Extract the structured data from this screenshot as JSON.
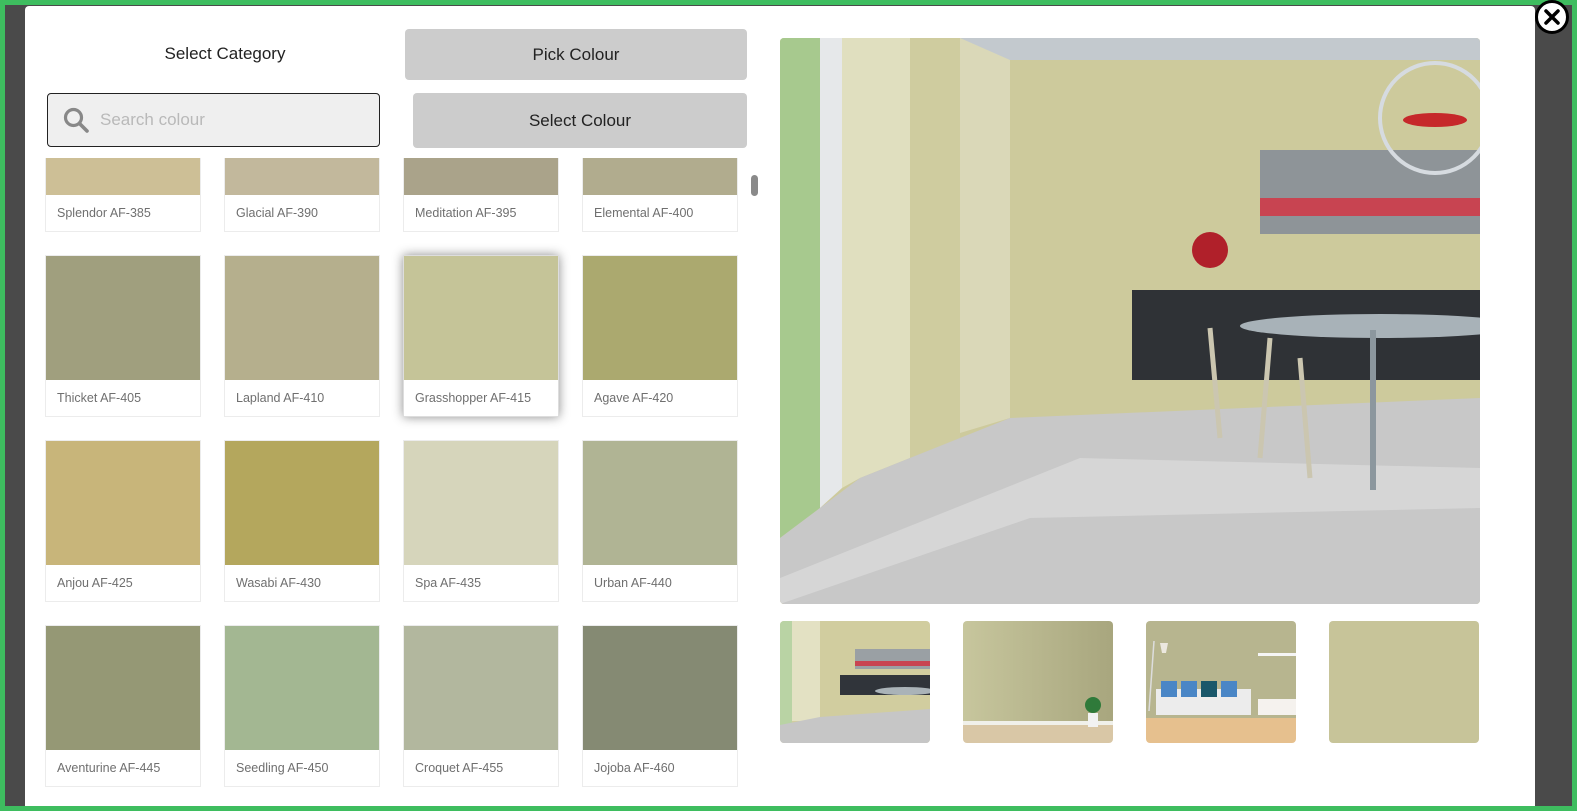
{
  "header": {
    "category_label": "Select Category",
    "pick_colour_label": "Pick Colour",
    "select_colour_label": "Select Colour"
  },
  "search": {
    "placeholder": "Search colour",
    "value": ""
  },
  "close_icon": "close-circle-icon",
  "selected_colour": "Grasshopper AF-415",
  "swatches": [
    {
      "name": "Splendor AF-385",
      "color": "#cdbf96"
    },
    {
      "name": "Glacial AF-390",
      "color": "#c2b89c"
    },
    {
      "name": "Meditation AF-395",
      "color": "#aaa38a"
    },
    {
      "name": "Elemental AF-400",
      "color": "#b1ac8e"
    },
    {
      "name": "Thicket AF-405",
      "color": "#a09f7e"
    },
    {
      "name": "Lapland AF-410",
      "color": "#b5af8d"
    },
    {
      "name": "Grasshopper AF-415",
      "color": "#c5c498"
    },
    {
      "name": "Agave AF-420",
      "color": "#aba96f"
    },
    {
      "name": "Anjou AF-425",
      "color": "#c8b57a"
    },
    {
      "name": "Wasabi AF-430",
      "color": "#b4a75d"
    },
    {
      "name": "Spa AF-435",
      "color": "#d6d5bb"
    },
    {
      "name": "Urban AF-440",
      "color": "#b0b494"
    },
    {
      "name": "Aventurine AF-445",
      "color": "#959875"
    },
    {
      "name": "Seedling AF-450",
      "color": "#a3b792"
    },
    {
      "name": "Croquet AF-455",
      "color": "#b2b79e"
    },
    {
      "name": "Jojoba AF-460",
      "color": "#858a73"
    }
  ],
  "preview": {
    "scene": "dining-room",
    "wall_color": "#cdca9c"
  },
  "thumbnails": [
    {
      "scene": "dining-room",
      "label": "dining-room-thumbnail"
    },
    {
      "scene": "empty-wall-with-plant",
      "label": "empty-wall-thumbnail"
    },
    {
      "scene": "living-room-sofa",
      "label": "living-room-thumbnail"
    },
    {
      "scene": "plain-colour",
      "label": "plain-colour-thumbnail",
      "color": "#c7c499"
    }
  ]
}
